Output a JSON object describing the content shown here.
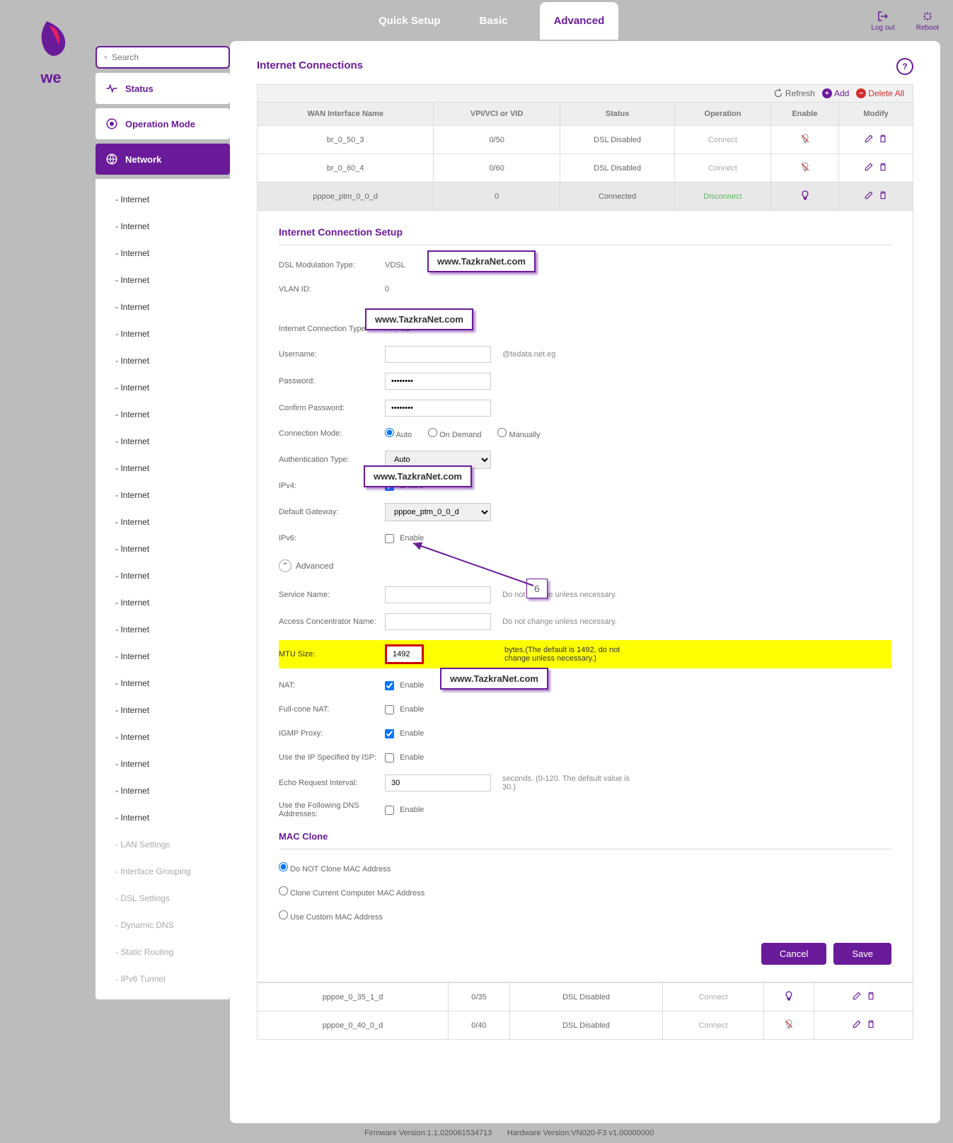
{
  "header": {
    "tabs": [
      "Quick Setup",
      "Basic",
      "Advanced"
    ],
    "logout": "Log out",
    "reboot": "Reboot"
  },
  "search": {
    "placeholder": "Search"
  },
  "sidebar": {
    "items": [
      {
        "icon": "pulse",
        "label": "Status"
      },
      {
        "icon": "target",
        "label": "Operation Mode"
      },
      {
        "icon": "globe",
        "label": "Network"
      }
    ],
    "sub": [
      "- Internet",
      "- Internet",
      "- Internet",
      "- Internet",
      "- Internet",
      "- Internet",
      "- Internet",
      "- Internet",
      "- Internet",
      "- Internet",
      "- Internet",
      "- Internet",
      "- Internet",
      "- Internet",
      "- Internet",
      "- Internet",
      "- Internet",
      "- Internet",
      "- Internet",
      "- Internet",
      "- Internet",
      "- Internet",
      "- Internet",
      "- Internet"
    ],
    "sub_muted": [
      "- LAN Settings",
      "- Interface Grouping",
      "- DSL Settings",
      "- Dynamic DNS",
      "- Static Routing",
      "- IPv6 Tunnel"
    ]
  },
  "panel": {
    "title": "Internet Connections",
    "help": "?"
  },
  "toolbar": {
    "refresh": "Refresh",
    "add": "Add",
    "delete": "Delete All"
  },
  "table": {
    "headers": [
      "WAN Interface Name",
      "VPI/VCI or VID",
      "Status",
      "Operation",
      "Enable",
      "Modify"
    ],
    "rows": [
      {
        "name": "br_0_50_3",
        "vid": "0/50",
        "status": "DSL Disabled",
        "op": "Connect",
        "op_cls": "op-conn",
        "enabled": false
      },
      {
        "name": "br_0_60_4",
        "vid": "0/60",
        "status": "DSL Disabled",
        "op": "Connect",
        "op_cls": "op-conn",
        "enabled": false
      },
      {
        "name": "pppoe_ptm_0_0_d",
        "vid": "0",
        "status": "Connected",
        "op": "Disconnect",
        "op_cls": "op-disc",
        "enabled": true
      }
    ],
    "tail": [
      {
        "name": "pppoe_0_35_1_d",
        "vid": "0/35",
        "status": "DSL Disabled",
        "op": "Connect",
        "op_cls": "op-conn",
        "enabled": true
      },
      {
        "name": "pppoe_0_40_0_d",
        "vid": "0/40",
        "status": "DSL Disabled",
        "op": "Connect",
        "op_cls": "op-conn",
        "enabled": false
      }
    ]
  },
  "form": {
    "title": "Internet Connection Setup",
    "dsl_mod_lbl": "DSL Modulation Type:",
    "dsl_mod_val": "VDSL",
    "vlan_lbl": "VLAN ID:",
    "vlan_val": "0",
    "ict_lbl": "Internet Connection Type:",
    "ict_val": "PPPoE",
    "user_lbl": "Username:",
    "user_suffix": "@tedata.net.eg",
    "pwd_lbl": "Password:",
    "pwd_val": "********",
    "cpwd_lbl": "Confirm Password:",
    "cpwd_val": "********",
    "mode_lbl": "Connection Mode:",
    "mode_opts": [
      "Auto",
      "On Demand",
      "Manually"
    ],
    "auth_lbl": "Authentication Type:",
    "auth_val": "Auto",
    "ipv4_lbl": "IPv4:",
    "enable": "Enable",
    "gw_lbl": "Default Gateway:",
    "gw_val": "pppoe_ptm_0_0_d",
    "ipv6_lbl": "IPv6:",
    "adv_toggle": "Advanced",
    "svc_lbl": "Service Name:",
    "svc_hint": "Do not change unless necessary.",
    "acn_lbl": "Access Concentrator Name:",
    "acn_hint": "Do not change unless necessary.",
    "mtu_lbl": "MTU Size:",
    "mtu_val": "1492",
    "mtu_hint": "bytes.(The default is 1492, do not change unless necessary.)",
    "nat_lbl": "NAT:",
    "fnat_lbl": "Full-cone NAT:",
    "igmp_lbl": "IGMP Proxy:",
    "isp_lbl": "Use the IP Specified by ISP:",
    "echo_lbl": "Echo Request Interval:",
    "echo_val": "30",
    "echo_hint": "seconds. (0-120. The default value is 30.)",
    "dns_lbl": "Use the Following DNS Addresses:",
    "mac_title": "MAC Clone",
    "mac_opts": [
      "Do NOT Clone MAC Address",
      "Clone Current Computer MAC Address",
      "Use Custom MAC Address"
    ],
    "cancel": "Cancel",
    "save": "Save"
  },
  "watermark": "www.TazkraNet.com",
  "callout": "6",
  "footer": {
    "fw": "Firmware Version:1.1.020061534713",
    "hw": "Hardware Version:VN020-F3 v1.00000000"
  }
}
